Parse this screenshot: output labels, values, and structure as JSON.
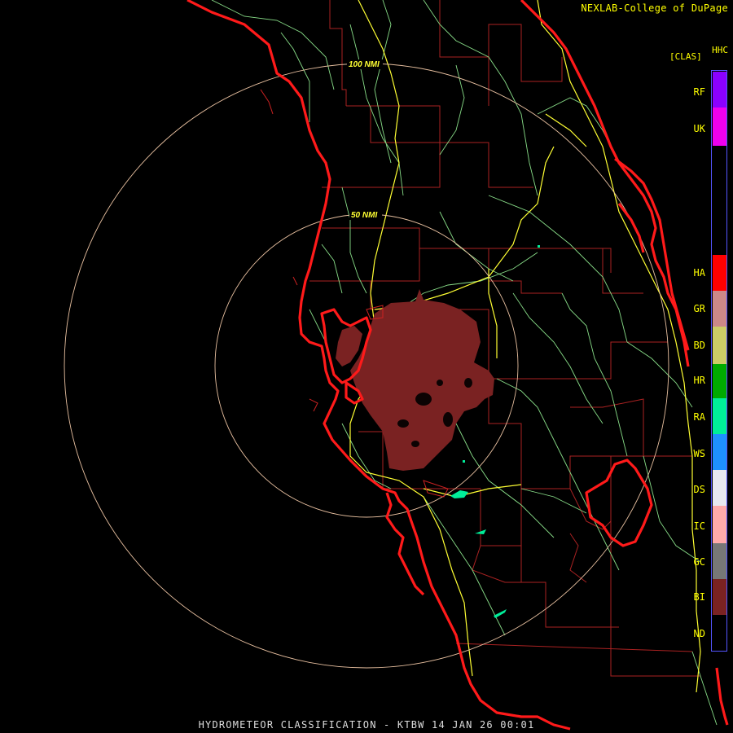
{
  "credit": "NEXLAB-College of DuPage",
  "product_code": "HHC",
  "units": "[CLAS]",
  "legend": [
    {
      "label": "RF",
      "color": "#8b00ff"
    },
    {
      "label": "UK",
      "color": "#ee00ee"
    },
    {
      "label": "HA",
      "color": "#ff0000"
    },
    {
      "label": "GR",
      "color": "#cc8888"
    },
    {
      "label": "BD",
      "color": "#cccc66"
    },
    {
      "label": "HR",
      "color": "#00aa00"
    },
    {
      "label": "RA",
      "color": "#00ee99"
    },
    {
      "label": "WS",
      "color": "#1e90ff"
    },
    {
      "label": "DS",
      "color": "#e8e8f0"
    },
    {
      "label": "IC",
      "color": "#ffaaaa"
    },
    {
      "label": "GC",
      "color": "#777777"
    },
    {
      "label": "BI",
      "color": "#7a2222"
    },
    {
      "label": "ND",
      "color": "#000000"
    }
  ],
  "range_rings": {
    "inner": "50 NMI",
    "outer": "100 NMI"
  },
  "footer": "HYDROMETEOR CLASSIFICATION - KTBW 14 JAN 26 00:01",
  "colors": {
    "coastline": "#ff1a1a",
    "county_lines": "#aa2222",
    "highways": "#ffff33",
    "roads": "#88dd88",
    "ring": "#e8c0a0",
    "echo_main": "#7a2222",
    "echo_ra": "#00ee99"
  }
}
